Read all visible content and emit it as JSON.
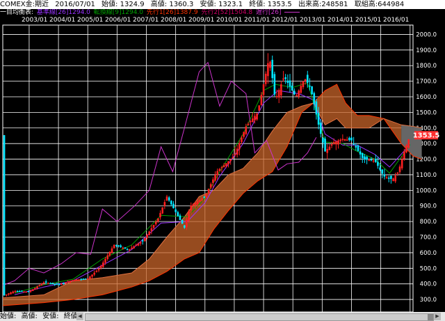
{
  "header": {
    "title": "COMEX金:期近",
    "date": "2016/07/01",
    "open": "始値: 1324.9",
    "high": "高値: 1360.3",
    "low": "安値: 1323.1",
    "close": "終値: 1353.5",
    "volume": "出来高:248581",
    "oi": "取組高:644984"
  },
  "legend": {
    "title": "一目均衡表:",
    "base": "基準線[26]1294.0",
    "conv": "転換線[9]1294.0",
    "spanA": "先行1[26]1387.9",
    "spanB": "先行2[52]1504.8",
    "lag": "遅行[26]",
    "colors": {
      "base": "#9933ff",
      "conv": "#00a000",
      "spanA": "#ff3300",
      "spanB": "#cc0066",
      "lag": "#cc33cc"
    }
  },
  "date_labels": [
    "2003/01",
    "2004/01",
    "2005/01",
    "2006/01",
    "2007/01",
    "2008/01",
    "2009/01",
    "2010/01",
    "2011/01",
    "2012/01",
    "2013/01",
    "2014/01",
    "2015/01",
    "2016/01"
  ],
  "price_tag": "1353.5",
  "footer": {
    "open": "始値:",
    "high": "高値:",
    "low": "安値:",
    "close": "終値:",
    "scroll_left": "◀",
    "scroll_right": "▶"
  },
  "chart_data": {
    "type": "line",
    "title": "COMEX金:期近",
    "ylim": [
      220,
      2060
    ],
    "yticks": [
      300,
      400,
      500,
      600,
      700,
      800,
      900,
      1000,
      1100,
      1200,
      1300,
      1400,
      1500,
      1600,
      1700,
      1800,
      1900,
      2000
    ],
    "x_range": [
      2002.6,
      2016.6
    ],
    "grid": true,
    "colors": {
      "grid": "#ffffff",
      "up": "#ff2020",
      "down": "#00e5ff",
      "cloud_up": "#c8642a",
      "cloud_down": "#666666",
      "tag": "#ff3030"
    },
    "close_series": [
      [
        2002.6,
        322
      ],
      [
        2003.0,
        355
      ],
      [
        2003.5,
        350
      ],
      [
        2004.0,
        410
      ],
      [
        2004.5,
        395
      ],
      [
        2005.0,
        425
      ],
      [
        2005.5,
        435
      ],
      [
        2005.9,
        500
      ],
      [
        2006.4,
        650
      ],
      [
        2006.9,
        620
      ],
      [
        2007.4,
        680
      ],
      [
        2007.9,
        820
      ],
      [
        2008.2,
        960
      ],
      [
        2008.8,
        760
      ],
      [
        2009.0,
        900
      ],
      [
        2009.5,
        960
      ],
      [
        2009.9,
        1120
      ],
      [
        2010.5,
        1220
      ],
      [
        2010.9,
        1410
      ],
      [
        2011.3,
        1500
      ],
      [
        2011.7,
        1860
      ],
      [
        2011.9,
        1580
      ],
      [
        2012.2,
        1730
      ],
      [
        2012.6,
        1600
      ],
      [
        2012.9,
        1720
      ],
      [
        2013.1,
        1660
      ],
      [
        2013.4,
        1400
      ],
      [
        2013.6,
        1250
      ],
      [
        2013.9,
        1310
      ],
      [
        2014.2,
        1330
      ],
      [
        2014.5,
        1320
      ],
      [
        2014.9,
        1200
      ],
      [
        2015.3,
        1190
      ],
      [
        2015.6,
        1090
      ],
      [
        2015.9,
        1070
      ],
      [
        2016.1,
        1120
      ],
      [
        2016.3,
        1250
      ],
      [
        2016.5,
        1353.5
      ]
    ],
    "series": [
      {
        "name": "基準線",
        "values": [
          [
            2003.0,
            330
          ],
          [
            2004.0,
            380
          ],
          [
            2005.0,
            420
          ],
          [
            2006.0,
            520
          ],
          [
            2007.0,
            620
          ],
          [
            2008.0,
            790
          ],
          [
            2008.9,
            800
          ],
          [
            2009.5,
            920
          ],
          [
            2010.0,
            1090
          ],
          [
            2010.8,
            1300
          ],
          [
            2011.5,
            1560
          ],
          [
            2012.0,
            1640
          ],
          [
            2012.7,
            1620
          ],
          [
            2013.2,
            1580
          ],
          [
            2013.6,
            1360
          ],
          [
            2014.2,
            1290
          ],
          [
            2014.7,
            1290
          ],
          [
            2015.3,
            1230
          ],
          [
            2015.8,
            1150
          ],
          [
            2016.5,
            1294
          ]
        ]
      },
      {
        "name": "転換線",
        "values": [
          [
            2003.0,
            340
          ],
          [
            2004.0,
            395
          ],
          [
            2005.0,
            430
          ],
          [
            2006.0,
            560
          ],
          [
            2007.0,
            650
          ],
          [
            2008.0,
            840
          ],
          [
            2008.9,
            830
          ],
          [
            2009.5,
            950
          ],
          [
            2010.0,
            1120
          ],
          [
            2010.8,
            1360
          ],
          [
            2011.5,
            1640
          ],
          [
            2011.9,
            1680
          ],
          [
            2012.5,
            1660
          ],
          [
            2013.0,
            1690
          ],
          [
            2013.6,
            1310
          ],
          [
            2014.2,
            1300
          ],
          [
            2014.7,
            1250
          ],
          [
            2015.3,
            1200
          ],
          [
            2015.8,
            1110
          ],
          [
            2016.5,
            1294
          ]
        ]
      },
      {
        "name": "遅行",
        "values": [
          [
            2002.6,
            390
          ],
          [
            2003.0,
            420
          ],
          [
            2003.5,
            500
          ],
          [
            2004.0,
            470
          ],
          [
            2004.6,
            530
          ],
          [
            2005.1,
            600
          ],
          [
            2005.6,
            590
          ],
          [
            2006.0,
            880
          ],
          [
            2006.5,
            800
          ],
          [
            2007.1,
            900
          ],
          [
            2007.6,
            1000
          ],
          [
            2008.0,
            1280
          ],
          [
            2008.4,
            1120
          ],
          [
            2008.8,
            1400
          ],
          [
            2009.3,
            1760
          ],
          [
            2009.6,
            1820
          ],
          [
            2010.0,
            1540
          ],
          [
            2010.4,
            1700
          ],
          [
            2010.9,
            1620
          ],
          [
            2011.2,
            1240
          ],
          [
            2011.6,
            1320
          ],
          [
            2012.0,
            1130
          ],
          [
            2012.3,
            1170
          ],
          [
            2012.7,
            1180
          ],
          [
            2013.0,
            1240
          ],
          [
            2013.3,
            1340
          ]
        ]
      }
    ],
    "cloud": {
      "span_a": [
        [
          2002.6,
          260
        ],
        [
          2004.0,
          280
        ],
        [
          2005.0,
          300
        ],
        [
          2006.0,
          330
        ],
        [
          2007.0,
          380
        ],
        [
          2007.6,
          420
        ],
        [
          2008.2,
          480
        ],
        [
          2008.8,
          560
        ],
        [
          2009.3,
          600
        ],
        [
          2009.8,
          750
        ],
        [
          2010.3,
          870
        ],
        [
          2010.8,
          980
        ],
        [
          2011.3,
          1060
        ],
        [
          2011.8,
          1120
        ],
        [
          2012.3,
          1280
        ],
        [
          2012.8,
          1500
        ],
        [
          2013.2,
          1560
        ],
        [
          2013.6,
          1640
        ],
        [
          2014.0,
          1680
        ],
        [
          2014.3,
          1560
        ],
        [
          2014.7,
          1480
        ],
        [
          2015.1,
          1480
        ],
        [
          2015.6,
          1460
        ],
        [
          2016.2,
          1300
        ],
        [
          2016.6,
          1220
        ],
        [
          2016.9,
          1200
        ]
      ],
      "span_b": [
        [
          2002.6,
          310
        ],
        [
          2004.0,
          330
        ],
        [
          2005.0,
          420
        ],
        [
          2006.0,
          440
        ],
        [
          2007.0,
          470
        ],
        [
          2007.6,
          560
        ],
        [
          2008.2,
          700
        ],
        [
          2008.8,
          830
        ],
        [
          2009.3,
          960
        ],
        [
          2009.8,
          1000
        ],
        [
          2010.3,
          1100
        ],
        [
          2010.8,
          1140
        ],
        [
          2011.3,
          1240
        ],
        [
          2011.8,
          1380
        ],
        [
          2012.3,
          1500
        ],
        [
          2012.8,
          1540
        ],
        [
          2013.2,
          1560
        ],
        [
          2013.6,
          1420
        ],
        [
          2014.0,
          1460
        ],
        [
          2014.3,
          1400
        ],
        [
          2014.7,
          1400
        ],
        [
          2015.1,
          1400
        ],
        [
          2015.6,
          1460
        ],
        [
          2016.2,
          1420
        ],
        [
          2016.6,
          1410
        ],
        [
          2016.9,
          1400
        ]
      ]
    }
  }
}
